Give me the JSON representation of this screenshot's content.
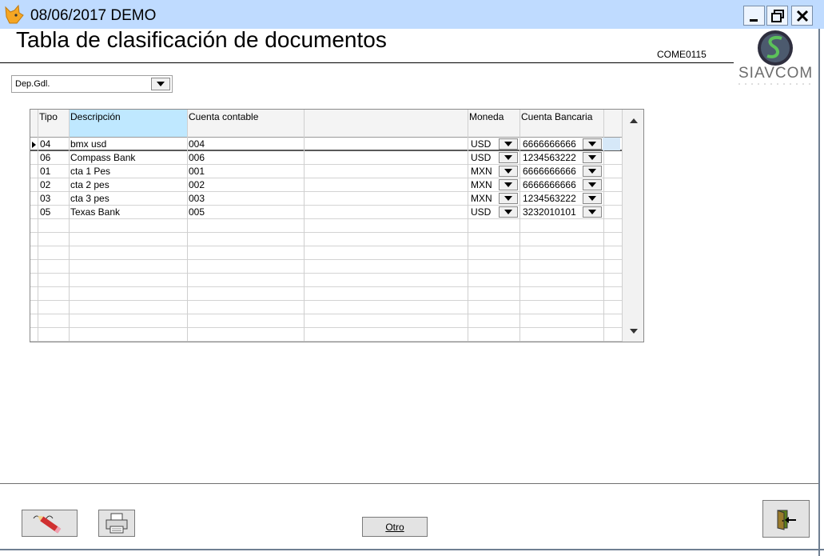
{
  "window": {
    "title": "08/06/2017  DEMO",
    "icon": "fox-app-icon",
    "controls": [
      "minimize-icon",
      "restore-icon",
      "close-icon"
    ]
  },
  "form": {
    "title": "Tabla de clasificación de documentos",
    "code": "COME0115"
  },
  "logo": {
    "text": "SIAVCOM"
  },
  "branch": {
    "value": "Dep.Gdl."
  },
  "grid": {
    "headers": {
      "tipo": "Tipo",
      "descripcion": "Descripción",
      "cuenta": "Cuenta contable",
      "moneda": "Moneda",
      "banco": "Cuenta Bancaria"
    },
    "rows": [
      {
        "tipo": "04",
        "descripcion": "bmx usd",
        "cuenta": "004",
        "moneda": "USD",
        "banco": "6666666666"
      },
      {
        "tipo": "06",
        "descripcion": "Compass Bank",
        "cuenta": "006",
        "moneda": "USD",
        "banco": "1234563222"
      },
      {
        "tipo": "01",
        "descripcion": "cta 1 Pes",
        "cuenta": "001",
        "moneda": "MXN",
        "banco": "6666666666"
      },
      {
        "tipo": "02",
        "descripcion": "cta 2 pes",
        "cuenta": "002",
        "moneda": "MXN",
        "banco": "6666666666"
      },
      {
        "tipo": "03",
        "descripcion": "cta 3 pes",
        "cuenta": "003",
        "moneda": "MXN",
        "banco": "1234563222"
      },
      {
        "tipo": "05",
        "descripcion": "Texas Bank",
        "cuenta": "005",
        "moneda": "USD",
        "banco": "3232010101"
      }
    ]
  },
  "footer": {
    "otro_label": "Otro",
    "buttons": [
      "edit-icon",
      "print-icon",
      "exit-door-icon"
    ]
  }
}
